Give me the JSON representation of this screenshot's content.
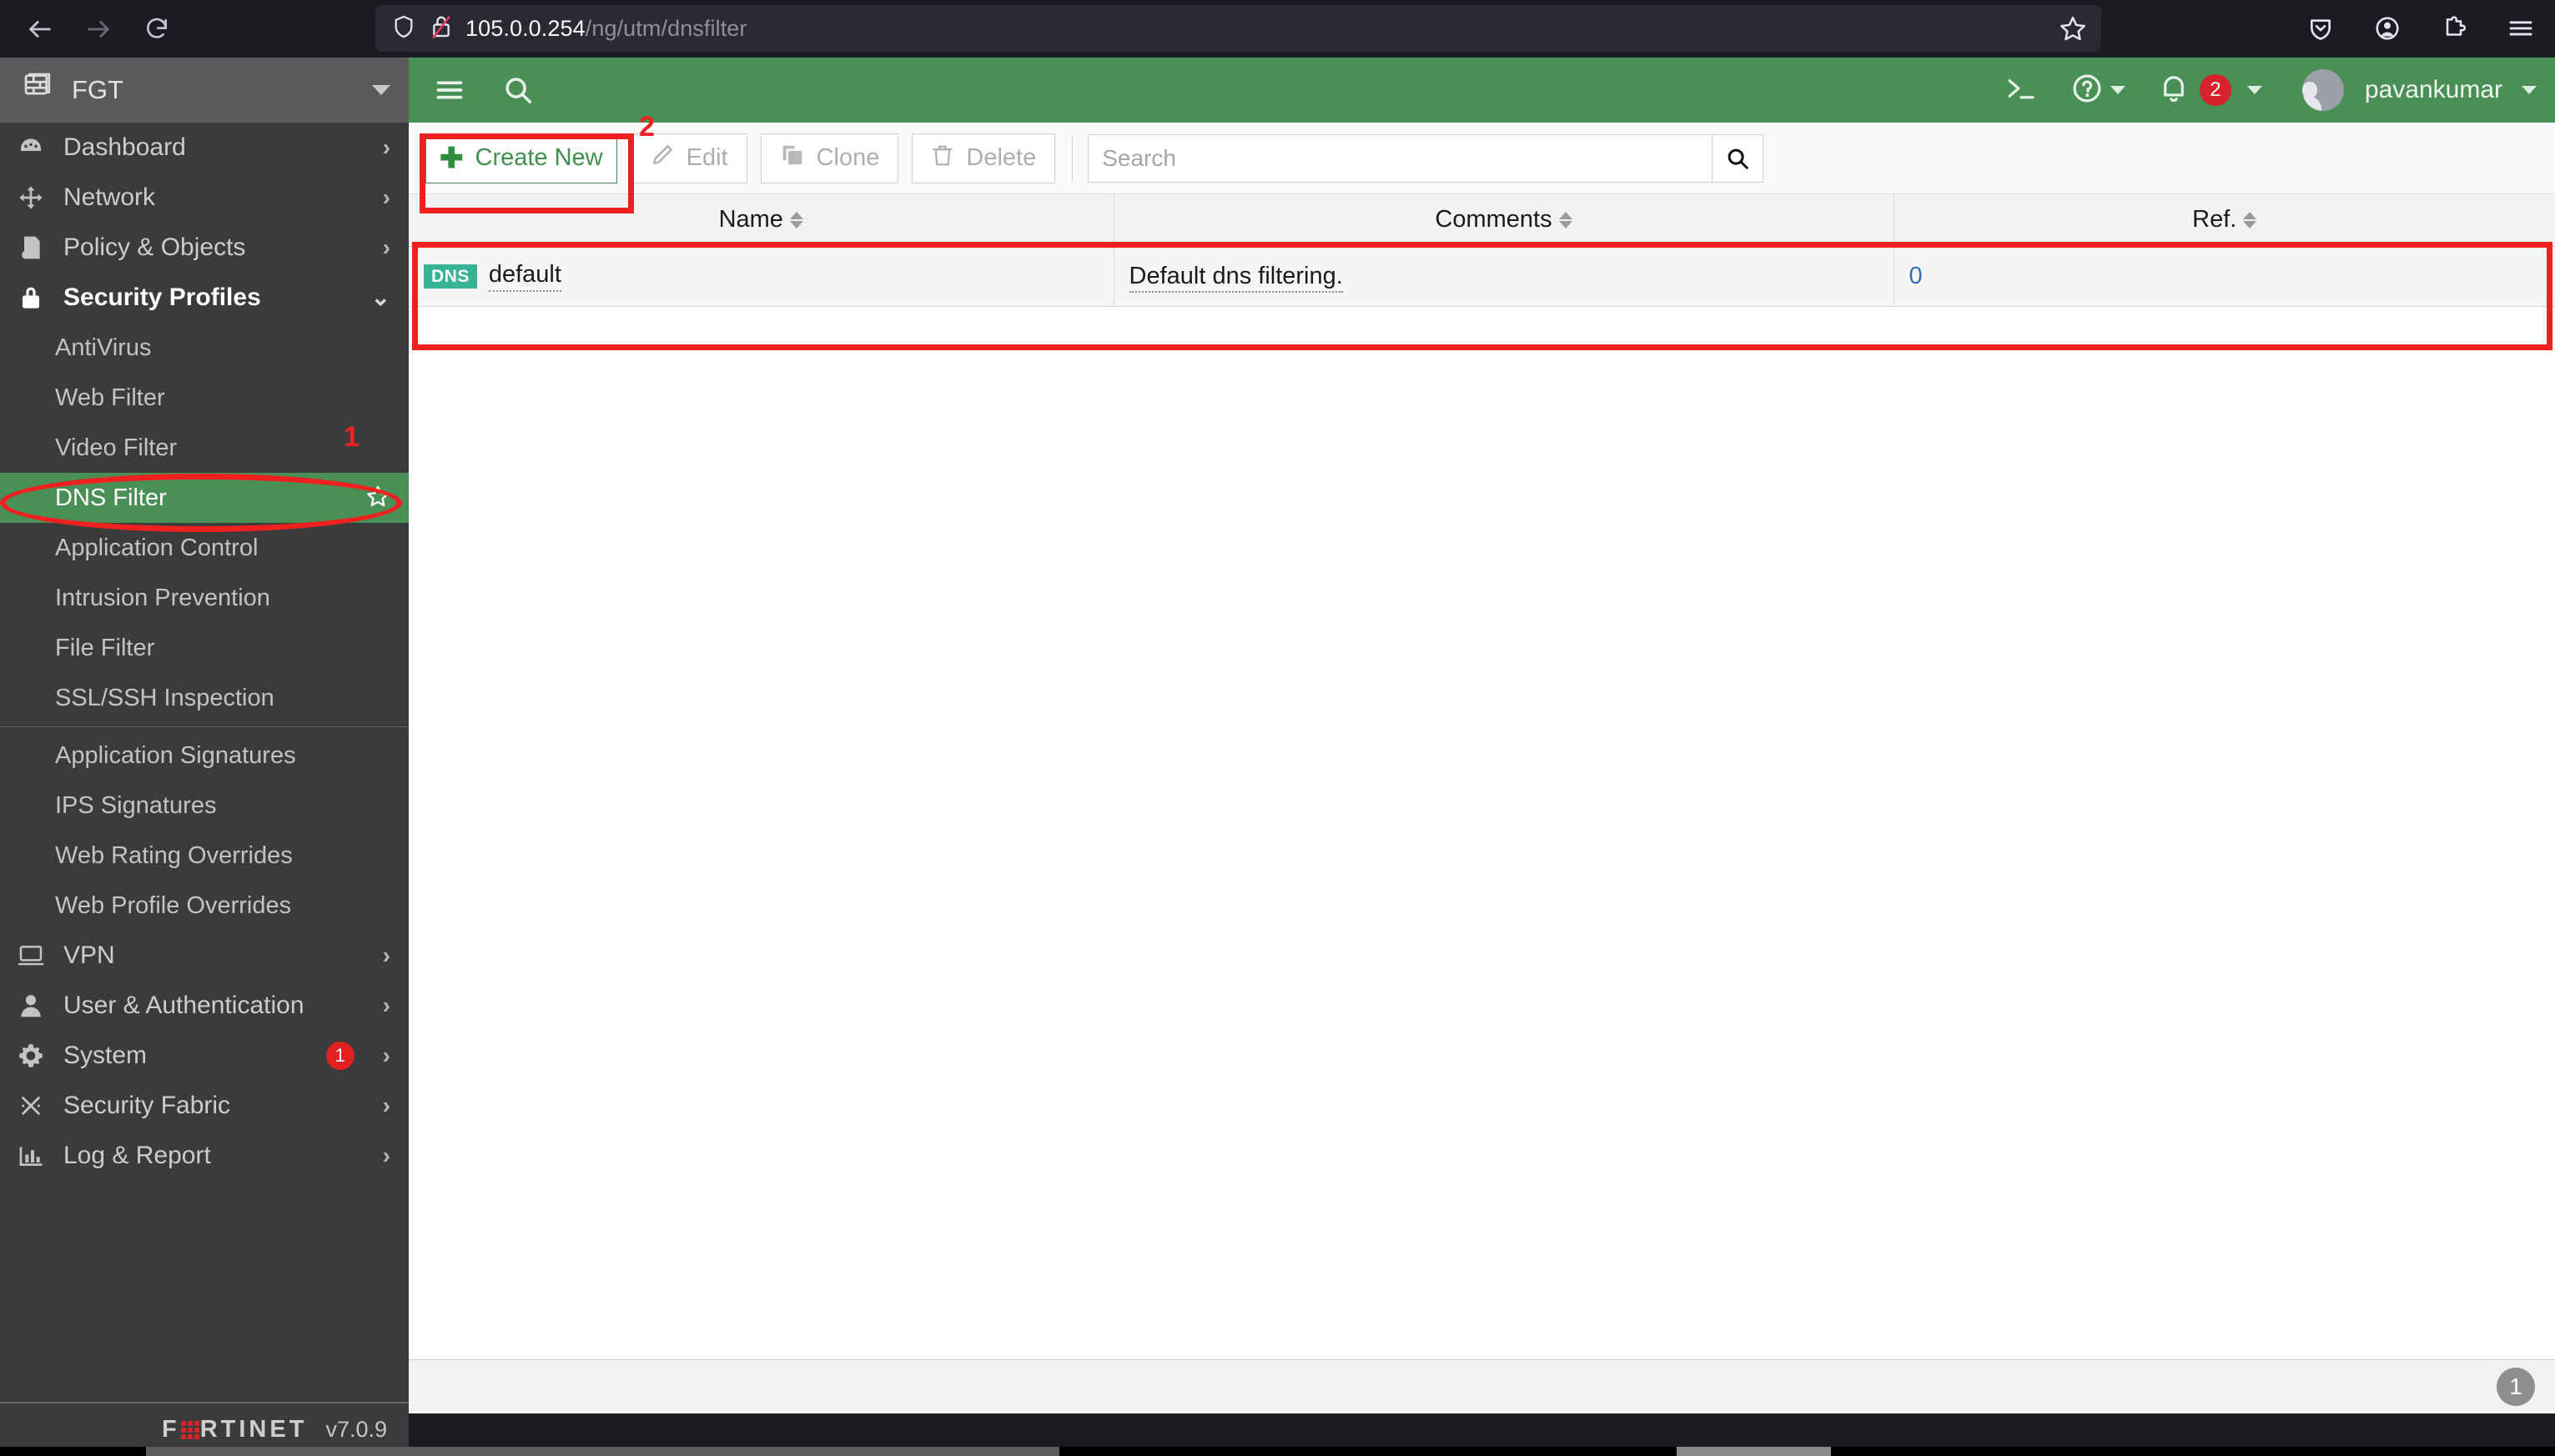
{
  "browser": {
    "back_icon": "back-arrow-icon",
    "forward_icon": "forward-arrow-icon",
    "reload_icon": "reload-icon",
    "shield_icon": "tracking-protection-shield-icon",
    "lock_icon": "insecure-connection-lock-icon",
    "url_host": "105.0.0.254",
    "url_path": "/ng/utm/dnsfilter",
    "star_icon": "bookmark-star-icon",
    "pocket_icon": "pocket-save-icon",
    "account_icon": "firefox-account-icon",
    "extensions_icon": "extensions-puzzle-icon",
    "menu_icon": "hamburger-menu-icon"
  },
  "fos_header": {
    "menu_toggle_icon": "hamburger-menu-icon",
    "search_icon": "search-icon",
    "cli_icon": "cli-console-icon",
    "help_icon": "help-question-icon",
    "notification_icon": "notification-bell-icon",
    "notification_count": "2",
    "avatar_icon": "user-avatar-icon",
    "username": "pavankumar",
    "accent_green": "#4a9056"
  },
  "sidebar": {
    "device_name": "FGT",
    "device_icon": "firewall-device-icon",
    "items": [
      {
        "label": "Dashboard",
        "icon": "dashboard-gauge-icon",
        "type": "group",
        "chevron": "right"
      },
      {
        "label": "Network",
        "icon": "network-move-icon",
        "type": "group",
        "chevron": "right"
      },
      {
        "label": "Policy & Objects",
        "icon": "policy-document-icon",
        "type": "group",
        "chevron": "right"
      },
      {
        "label": "Security Profiles",
        "icon": "lock-icon",
        "type": "group",
        "chevron": "down",
        "expanded": true
      }
    ],
    "security_profiles_children": [
      {
        "label": "AntiVirus"
      },
      {
        "label": "Web Filter"
      },
      {
        "label": "Video Filter"
      },
      {
        "label": "DNS Filter",
        "selected": true,
        "star_icon": "favorite-star-icon"
      },
      {
        "label": "Application Control"
      },
      {
        "label": "Intrusion Prevention"
      },
      {
        "label": "File Filter"
      },
      {
        "label": "SSL/SSH Inspection"
      },
      {
        "divider": true
      },
      {
        "label": "Application Signatures"
      },
      {
        "label": "IPS Signatures"
      },
      {
        "label": "Web Rating Overrides"
      },
      {
        "label": "Web Profile Overrides"
      }
    ],
    "bottom_items": [
      {
        "label": "VPN",
        "icon": "vpn-monitor-icon",
        "chevron": "right"
      },
      {
        "label": "User & Authentication",
        "icon": "user-icon",
        "chevron": "right"
      },
      {
        "label": "System",
        "icon": "gear-icon",
        "chevron": "right",
        "badge": "1"
      },
      {
        "label": "Security Fabric",
        "icon": "security-fabric-icon",
        "chevron": "right"
      },
      {
        "label": "Log & Report",
        "icon": "bar-chart-icon",
        "chevron": "right"
      }
    ],
    "footer": {
      "brand": "FORTINET",
      "version": "v7.0.9"
    }
  },
  "toolbar": {
    "create_new_label": "Create New",
    "create_new_icon": "plus-icon",
    "edit_label": "Edit",
    "edit_icon": "pencil-edit-icon",
    "clone_label": "Clone",
    "clone_icon": "clone-copy-icon",
    "delete_label": "Delete",
    "delete_icon": "trash-delete-icon",
    "search_placeholder": "Search",
    "search_value": "",
    "search_button_icon": "search-icon"
  },
  "table": {
    "columns": [
      {
        "label": "Name",
        "sortable": true
      },
      {
        "label": "Comments",
        "sortable": true
      },
      {
        "label": "Ref.",
        "sortable": true
      }
    ],
    "rows": [
      {
        "badge": "DNS",
        "name": "default",
        "comments": "Default dns filtering.",
        "ref": "0"
      }
    ]
  },
  "main_footer": {
    "badge": "1"
  },
  "annotations": [
    {
      "number": "1",
      "target": "dns-filter-sidebar-item"
    },
    {
      "number": "2",
      "target": "create-new-button"
    }
  ]
}
